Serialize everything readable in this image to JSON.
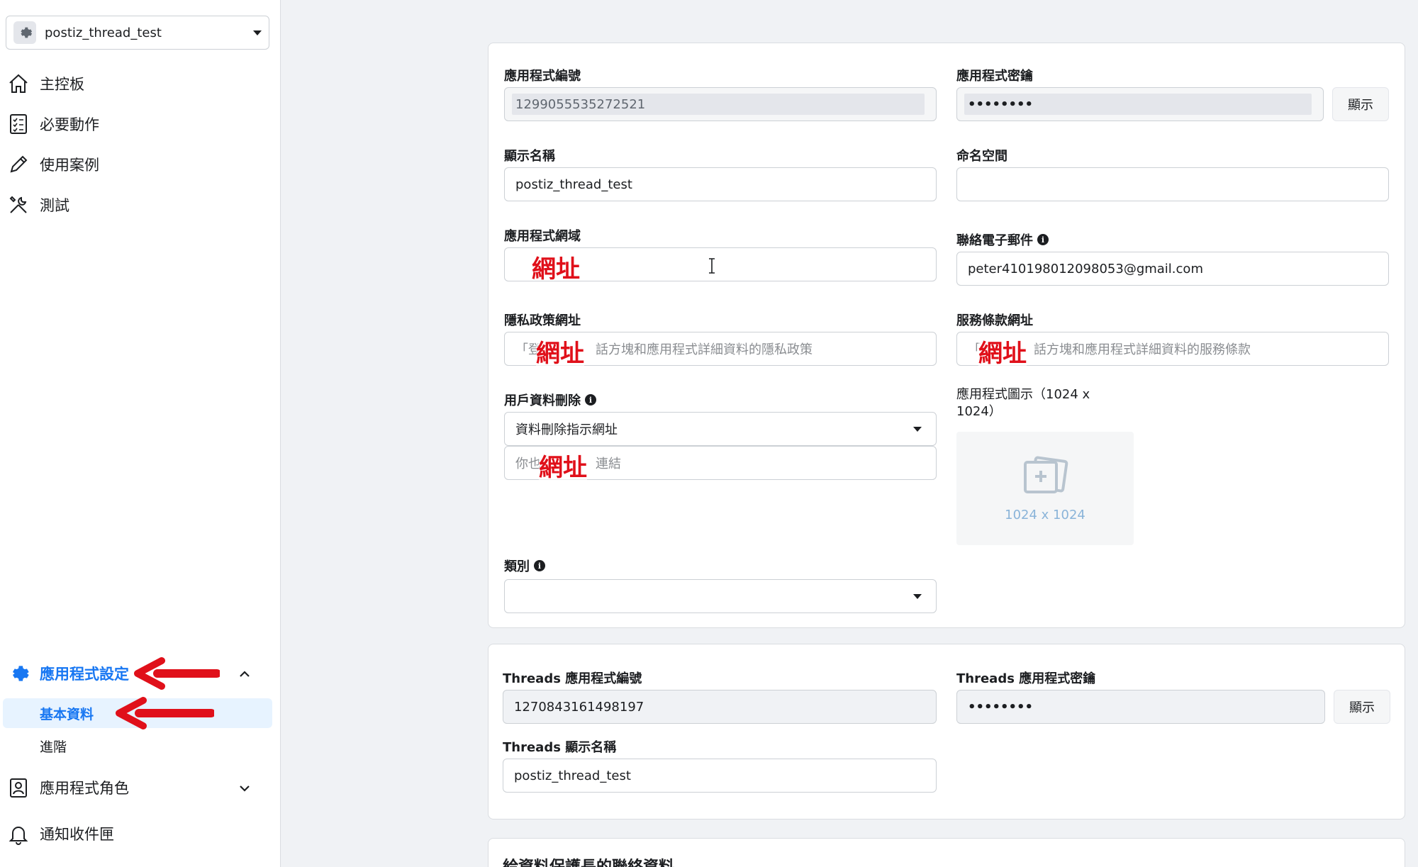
{
  "app_selector": {
    "name": "postiz_thread_test"
  },
  "sidebar": {
    "items": [
      {
        "label": "主控板",
        "icon": "home-icon"
      },
      {
        "label": "必要動作",
        "icon": "checklist-icon"
      },
      {
        "label": "使用案例",
        "icon": "pencil-icon"
      },
      {
        "label": "測試",
        "icon": "tools-icon"
      }
    ],
    "settings": {
      "label": "應用程式設定",
      "sub_items": [
        {
          "label": "基本資料",
          "active": true
        },
        {
          "label": "進階",
          "active": false
        }
      ]
    },
    "roles": {
      "label": "應用程式角色"
    },
    "inbox": {
      "label": "通知收件匣"
    }
  },
  "basic": {
    "app_id": {
      "label": "應用程式編號",
      "value": "1299055535272521"
    },
    "app_secret": {
      "label": "應用程式密鑰",
      "value": "••••••••",
      "show_button": "顯示"
    },
    "display_name": {
      "label": "顯示名稱",
      "value": "postiz_thread_test"
    },
    "namespace": {
      "label": "命名空間",
      "value": ""
    },
    "app_domain": {
      "label": "應用程式網域",
      "overlay": "網址"
    },
    "contact_email": {
      "label": "聯絡電子郵件",
      "value": "peter410198012098053@gmail.com"
    },
    "privacy_url": {
      "label": "隱私政策網址",
      "placeholder_prefix": "「登",
      "placeholder_suffix": "話方塊和應用程式詳細資料的隱私政策",
      "overlay": "網址"
    },
    "terms_url": {
      "label": "服務條款網址",
      "placeholder_prefix": "「",
      "placeholder_suffix": "話方塊和應用程式詳細資料的服務條款",
      "overlay": "網址"
    },
    "data_deletion": {
      "label": "用戶資料刪除",
      "select_value": "資料刪除指示網址",
      "input_prefix": "你也",
      "input_suffix": "連結",
      "overlay": "網址"
    },
    "app_icon": {
      "label_line1": "應用程式圖示（1024 x",
      "label_line2": "1024）",
      "size_text": "1024 x 1024"
    },
    "category": {
      "label": "類別",
      "value": ""
    }
  },
  "threads": {
    "app_id": {
      "label": "Threads 應用程式編號",
      "value": "1270843161498197"
    },
    "app_secret": {
      "label": "Threads 應用程式密鑰",
      "value": "••••••••",
      "show_button": "顯示"
    },
    "display_name": {
      "label": "Threads 顯示名稱",
      "value": "postiz_thread_test"
    }
  },
  "dpo_section": {
    "title": "給資料保護長的聯絡資料"
  },
  "colors": {
    "accent": "#1877f2",
    "annotation_red": "#e0101a"
  }
}
